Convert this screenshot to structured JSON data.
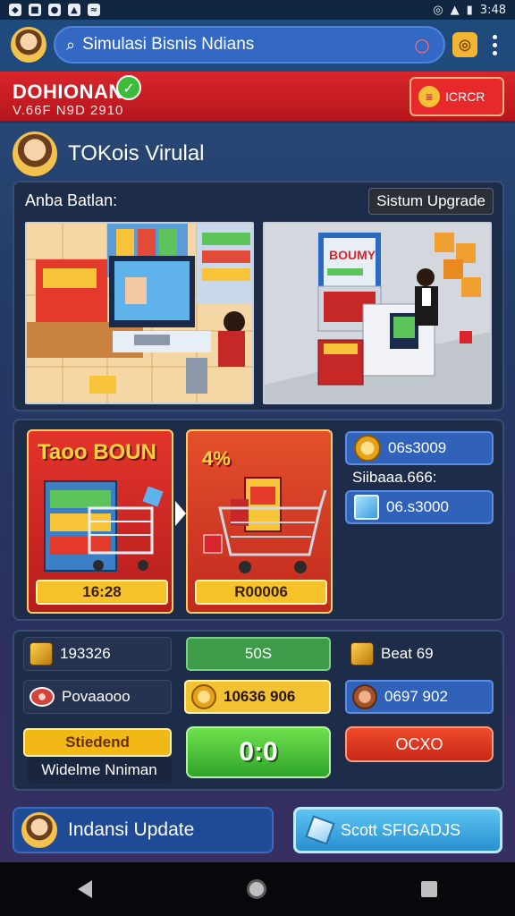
{
  "status_bar": {
    "time": "3:48"
  },
  "app_bar": {
    "search_text": "Simulasi Bisnis Ndians"
  },
  "banner": {
    "brand": "DOHIONAN",
    "subtitle": "V.66F N9D 2910",
    "button_label": "ICRCR"
  },
  "store": {
    "title": "TOKois Virulal"
  },
  "scenes_panel": {
    "label": "Anba Batlan:",
    "tag": "Sistum Upgrade"
  },
  "offers": [
    {
      "title": "Taoo BOUN",
      "price": "16:28"
    },
    {
      "title": "4%",
      "price": "R00006"
    }
  ],
  "resources": {
    "coins": "06s3009",
    "middle_text": "Siibaaa.666:",
    "gems": "06.s3000"
  },
  "stats": {
    "box_value": "193326",
    "green_value": "50S",
    "beat_value": "Beat 69",
    "meat_label": "Povaaooo",
    "coin_value": "10636 906",
    "coin2_value": "0697 902",
    "yellow_label": "Stiedend",
    "subtitle": "Widelme Nniman",
    "green_button": "0:0",
    "red_button": "OCXO"
  },
  "bottom": {
    "left_label": "Indansi Update",
    "right_label": "Scott SFIGADJS"
  }
}
